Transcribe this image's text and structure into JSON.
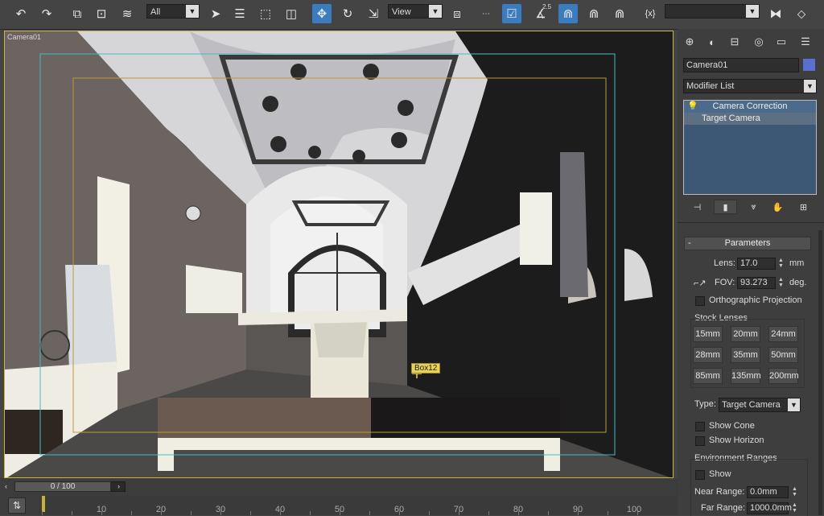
{
  "toolbar": {
    "selection_filter": "All",
    "reference_coord": "View",
    "snap_value": "2.5",
    "named_selection": "",
    "icons": [
      "undo-icon",
      "redo-icon",
      "link-icon",
      "unlink-icon",
      "bind-space-warp-icon",
      "select-object-icon",
      "select-by-name-icon",
      "rect-selection-region-icon",
      "window-crossing-icon",
      "move-icon",
      "rotate-icon",
      "scale-icon",
      "use-pivot-icon",
      "snap-toggle-icon",
      "angle-snap-icon",
      "percent-snap-icon",
      "spinner-snap-icon",
      "edit-named-selection-icon",
      "mirror-icon",
      "align-icon"
    ]
  },
  "viewport": {
    "label": "Camera01",
    "object_tag": "Box12"
  },
  "command_panel": {
    "object_name": "Camera01",
    "object_color": "#5b6fd0",
    "modifier_list": "Modifier List",
    "stack": [
      "Camera Correction",
      "Target Camera"
    ],
    "parameters_title": "Parameters",
    "lens_label": "Lens:",
    "lens_value": "17.0",
    "lens_unit": "mm",
    "fov_label": "FOV:",
    "fov_value": "93.273",
    "fov_unit": "deg.",
    "ortho_label": "Orthographic Projection",
    "stock_lenses_label": "Stock Lenses",
    "lenses": [
      "15mm",
      "20mm",
      "24mm",
      "28mm",
      "35mm",
      "50mm",
      "85mm",
      "135mm",
      "200mm"
    ],
    "type_label": "Type:",
    "type_value": "Target Camera",
    "show_cone": "Show Cone",
    "show_horizon": "Show Horizon",
    "env_ranges": "Environment Ranges",
    "show": "Show",
    "near_range_label": "Near Range:",
    "near_range_value": "0.0mm",
    "far_range_label": "Far Range:",
    "far_range_value": "1000.0mm"
  },
  "timeline": {
    "frame_display": "0 / 100",
    "ticks": [
      "10",
      "20",
      "30",
      "40",
      "50",
      "60",
      "70",
      "80",
      "90",
      "100"
    ]
  }
}
